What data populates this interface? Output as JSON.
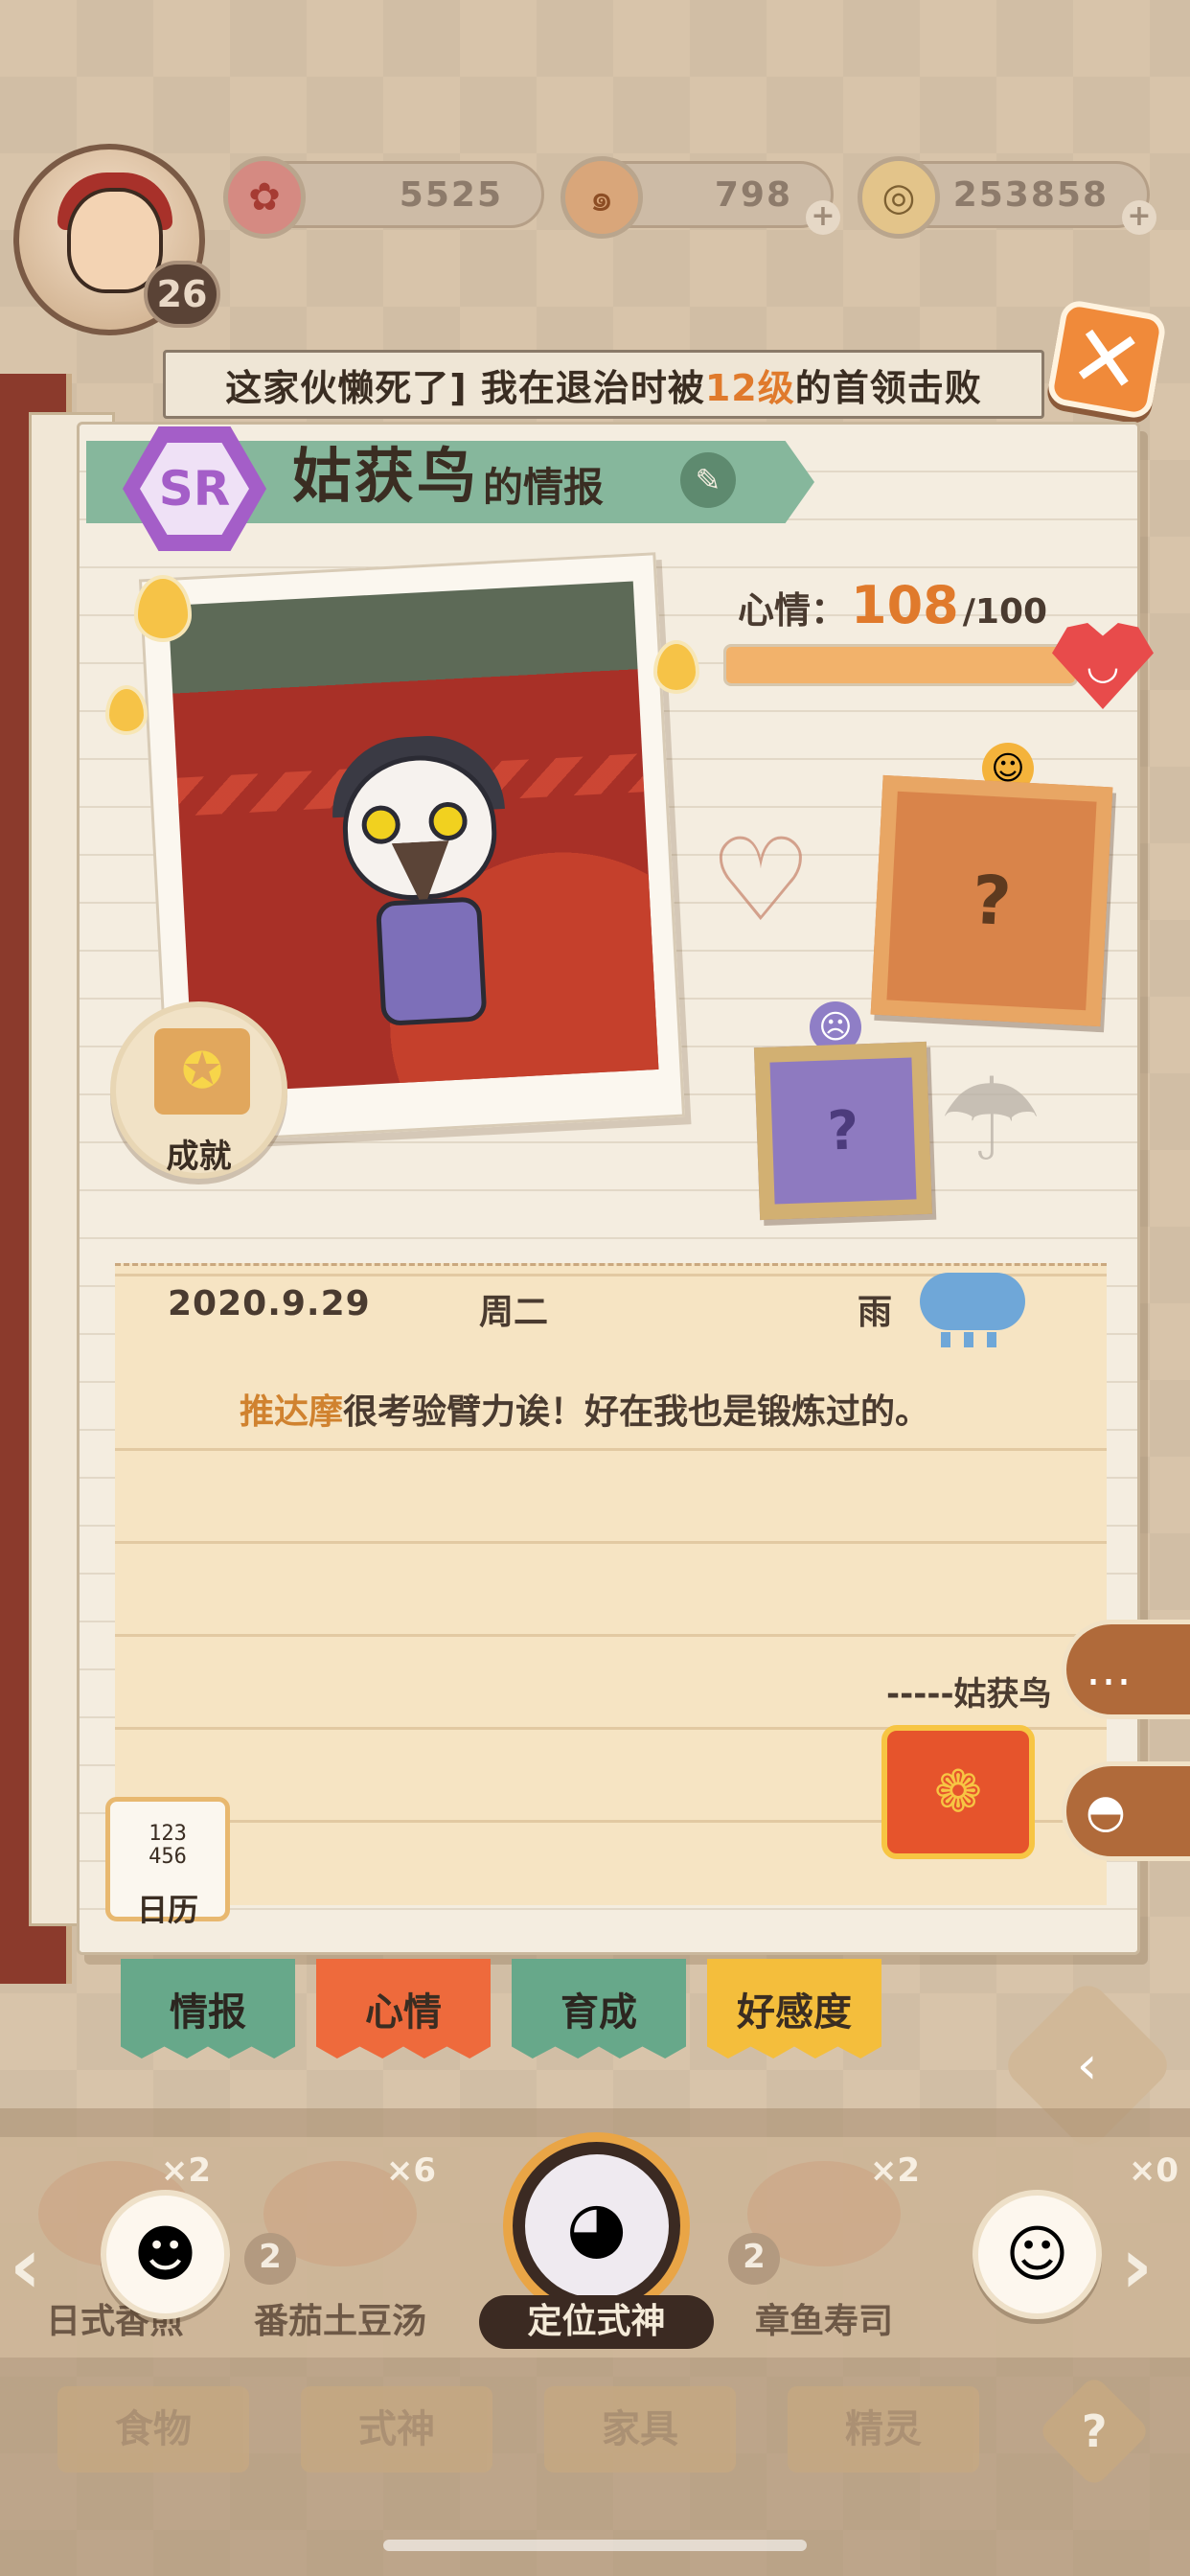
{
  "hud": {
    "player_level": "26",
    "resources": [
      {
        "icon": "plum-blossom-icon",
        "value": "5525"
      },
      {
        "icon": "magatama-icon",
        "value": "798"
      },
      {
        "icon": "coin-icon",
        "value": "253858"
      }
    ]
  },
  "banner": {
    "text_before": "这家伙懒死了] 我在退治时被",
    "highlight": "12级",
    "text_after": "的首领击败"
  },
  "profile": {
    "rarity": "SR",
    "name": "姑获鸟",
    "name_suffix": "的情报"
  },
  "achievements_label": "成就",
  "mood": {
    "label": "心情：",
    "value": "108",
    "max": "/100",
    "level": 1.0,
    "happy_frame": "?",
    "sad_frame": "?"
  },
  "diary": {
    "date": "2020.9.29",
    "weekday": "周二",
    "weather": "雨",
    "entry_highlight": "推达摩",
    "entry_text": "很考验臂力诶！好在我也是锻炼过的。",
    "signature": "-----姑获鸟"
  },
  "calendar": {
    "nums": "123\n456",
    "label": "日历"
  },
  "tabs": [
    {
      "label": "情报"
    },
    {
      "label": "心情"
    },
    {
      "label": "育成"
    },
    {
      "label": "好感度"
    }
  ],
  "dock": {
    "dishes": [
      {
        "name": "日式香煎",
        "qty": "×2",
        "level": "2"
      },
      {
        "name": "番茄土豆汤",
        "qty": "×6",
        "level": "2"
      },
      {
        "name": "章鱼寿司",
        "qty": "×2",
        "level": "2"
      },
      {
        "name": "",
        "qty": "×0",
        "level": ""
      }
    ],
    "center_label": "定位式神"
  },
  "bottom_tabs": [
    {
      "label": "食物"
    },
    {
      "label": "式神"
    },
    {
      "label": "家具"
    },
    {
      "label": "精灵"
    }
  ],
  "colors": {
    "accent_orange": "#e07a2c",
    "ribbon_green": "#86b79c",
    "sr_purple": "#a45ec8"
  }
}
